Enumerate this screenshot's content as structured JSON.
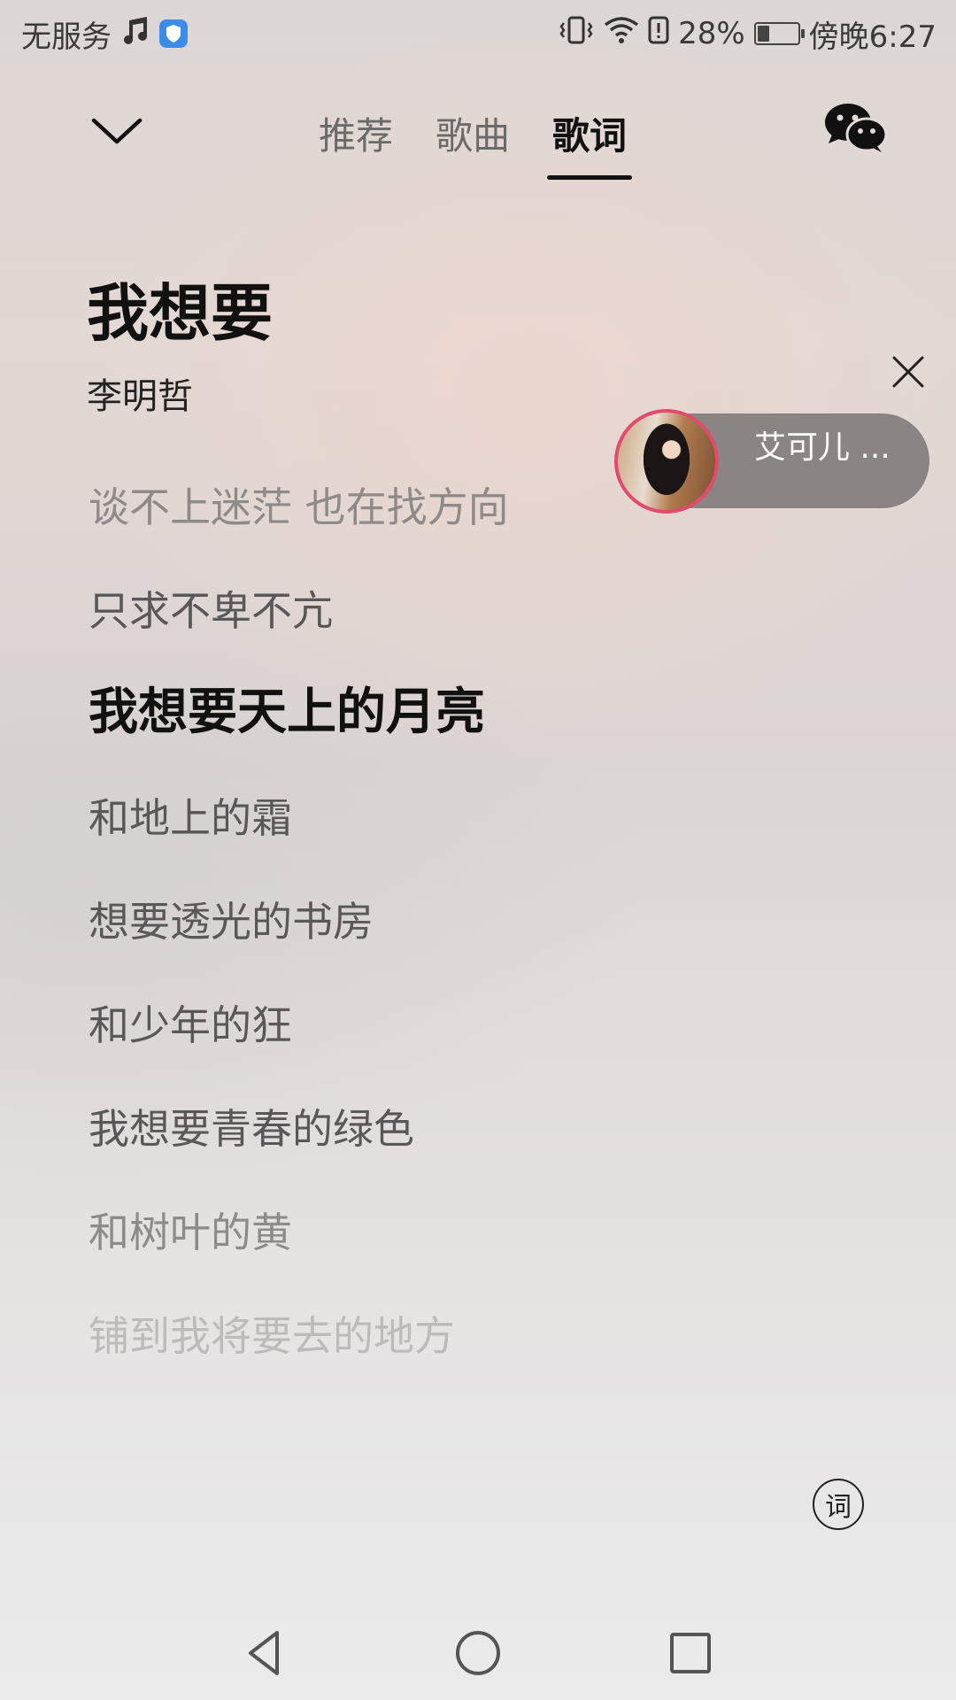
{
  "status_bar": {
    "carrier": "无服务",
    "battery_percent": "28%",
    "time": "傍晚6:27",
    "icons": [
      "music-note-icon",
      "shield-icon",
      "vibrate-icon",
      "wifi-icon",
      "alert-icon",
      "battery-icon"
    ]
  },
  "header": {
    "tabs": [
      {
        "label": "推荐",
        "active": false
      },
      {
        "label": "歌曲",
        "active": false
      },
      {
        "label": "歌词",
        "active": true
      }
    ]
  },
  "song": {
    "title": "我想要",
    "artist": "李明哲"
  },
  "lyrics": [
    {
      "text": "谈不上迷茫 也在找方向",
      "state": "past"
    },
    {
      "text": "只求不卑不亢",
      "state": "normal"
    },
    {
      "text": "我想要天上的月亮",
      "state": "current"
    },
    {
      "text": "和地上的霜",
      "state": "normal"
    },
    {
      "text": "想要透光的书房",
      "state": "normal"
    },
    {
      "text": "和少年的狂",
      "state": "normal"
    },
    {
      "text": "我想要青春的绿色",
      "state": "normal"
    },
    {
      "text": "和树叶的黄",
      "state": "faded"
    },
    {
      "text": "铺到我将要去的地方",
      "state": "faded-more"
    }
  ],
  "mini_player": {
    "title": "艾可儿 ...",
    "accent_color": "#e24a6e"
  },
  "lyric_toggle": {
    "label": "词"
  }
}
